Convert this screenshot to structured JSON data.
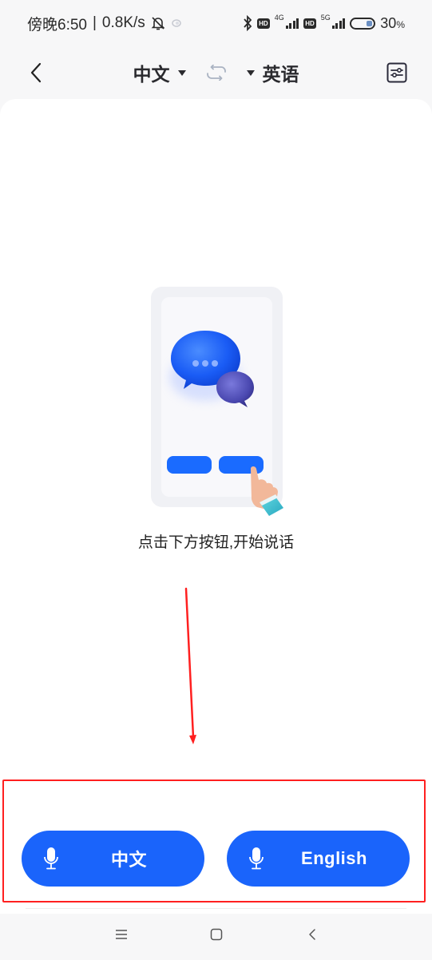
{
  "status_bar": {
    "time": "傍晚6:50",
    "separator": "|",
    "net_speed": "0.8K/s",
    "icons": [
      "bell-off-icon",
      "eye-care-icon",
      "bluetooth-icon",
      "hd-icon",
      "signal-4g-icon",
      "hd-icon",
      "signal-5g-icon",
      "battery-icon"
    ],
    "hd_label": "HD",
    "sim1_network": "4G",
    "sim2_network": "5G",
    "battery_percent": "30",
    "battery_unit": "%",
    "battery_level": 0.3
  },
  "nav": {
    "back_icon": "chevron-left-icon",
    "source_language": "中文",
    "target_language": "英语",
    "swap_icon": "swap-arrows-icon",
    "settings_icon": "sliders-settings-icon"
  },
  "main": {
    "illustration": "phone-chat-bubbles-tap-illustration",
    "hint": "点击下方按钮,开始说话"
  },
  "annotations": {
    "arrow_color": "#ff2020",
    "box_color": "#ff2020"
  },
  "buttons": {
    "left": {
      "icon": "microphone-icon",
      "label": "中文"
    },
    "right": {
      "icon": "microphone-icon",
      "label": "English"
    },
    "color": "#1a64fb"
  },
  "system_nav": {
    "menu_icon": "menu-icon",
    "home_icon": "home-square-icon",
    "back_icon": "back-chevron-icon"
  }
}
